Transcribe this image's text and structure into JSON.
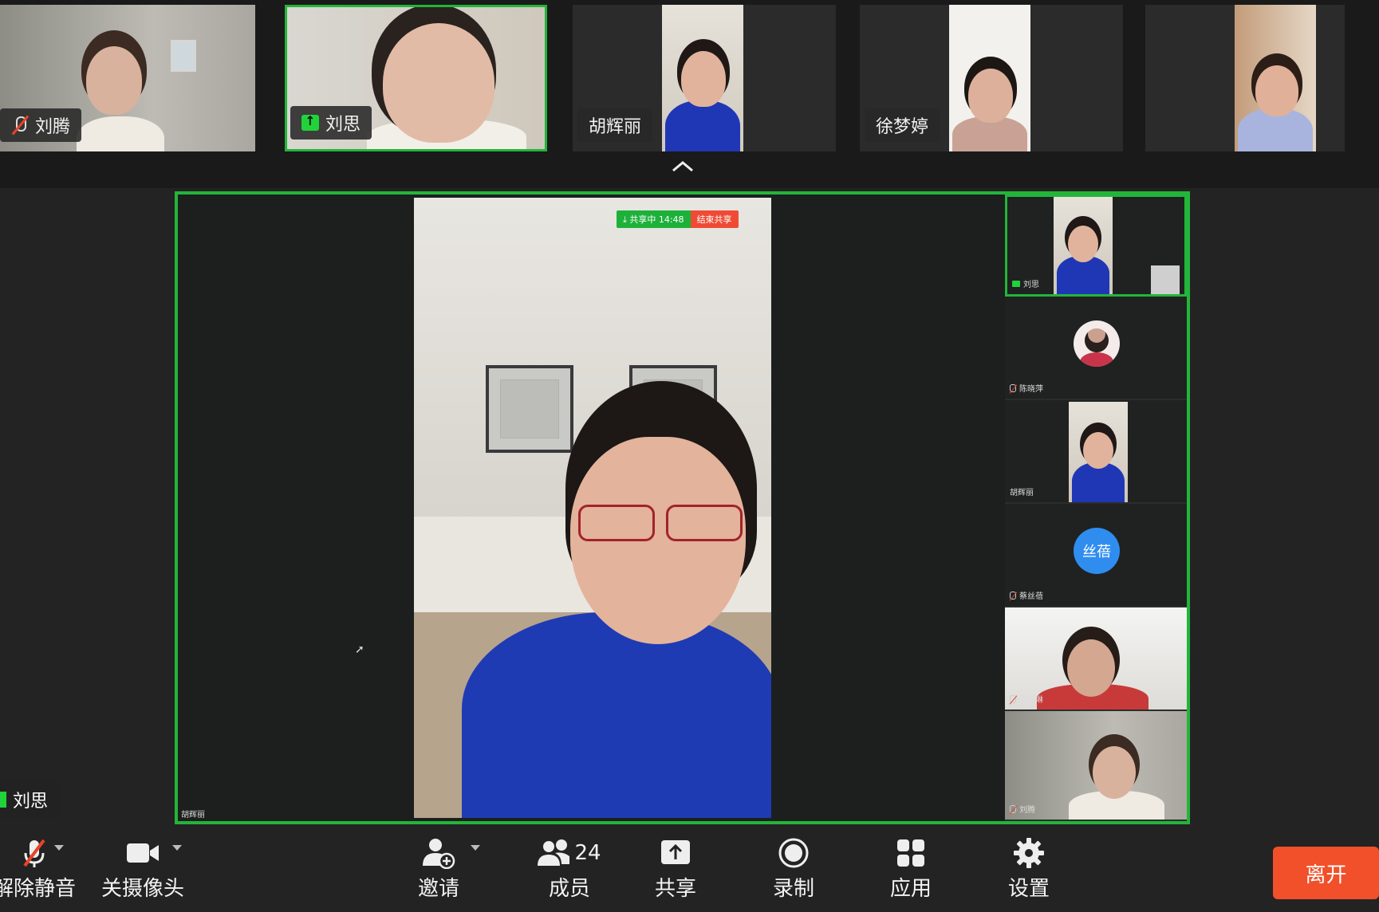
{
  "top_strip": {
    "tiles": [
      {
        "name": "刘腾",
        "status": "muted"
      },
      {
        "name": "刘思",
        "status": "sharing"
      },
      {
        "name": "胡辉丽",
        "status": "none"
      },
      {
        "name": "徐梦婷",
        "status": "none"
      },
      {
        "name": "",
        "status": "none"
      }
    ]
  },
  "share": {
    "status_label": "⤓ 共享中 14:48",
    "stop_label": "结束共享",
    "presenter_label": "胡辉丽"
  },
  "sidebar": {
    "tiles": [
      {
        "name": "刘思",
        "kind": "video",
        "icon": "share-icon"
      },
      {
        "name": "陈晓萍",
        "kind": "photo-avatar",
        "icon": "mic-muted-icon"
      },
      {
        "name": "胡辉丽",
        "kind": "video",
        "icon": ""
      },
      {
        "name": "蔡丝蓓",
        "kind": "text-avatar",
        "avatar_text": "丝蓓",
        "icon": "mic-muted-icon"
      },
      {
        "name": "汤玮琳",
        "kind": "video",
        "icon": "mic-muted-icon"
      },
      {
        "name": "刘腾",
        "kind": "video",
        "icon": "mic-muted-icon"
      }
    ]
  },
  "speaker_label": {
    "name": "刘思"
  },
  "toolbar": {
    "unmute_label": "解除静音",
    "camera_label": "关摄像头",
    "invite_label": "邀请",
    "members_label": "成员",
    "members_count": "24",
    "share_label": "共享",
    "record_label": "录制",
    "apps_label": "应用",
    "settings_label": "设置",
    "leave_label": "离开"
  },
  "colors": {
    "accent_green": "#23b53a",
    "leave_red": "#f1502a",
    "avatar_blue": "#2f8df0"
  }
}
